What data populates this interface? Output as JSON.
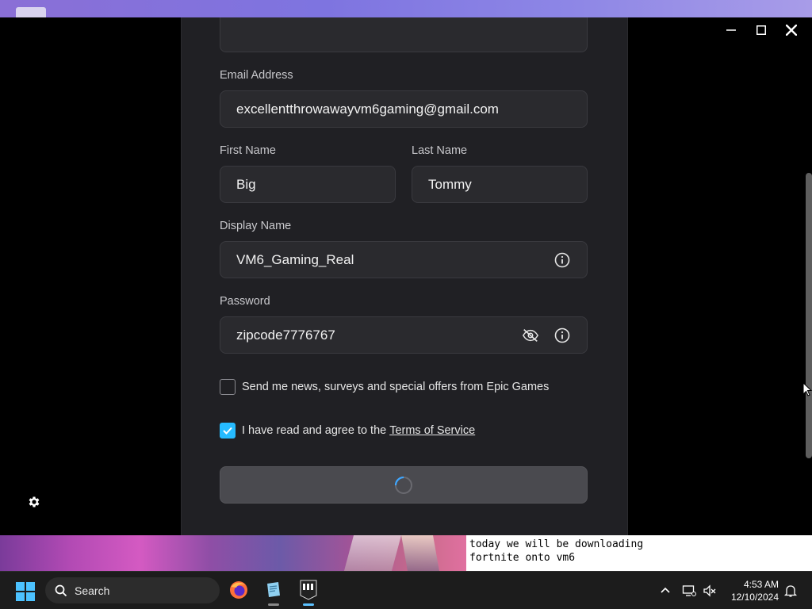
{
  "form": {
    "email_label": "Email Address",
    "email_value": "excellentthrowawayvm6gaming@gmail.com",
    "first_name_label": "First Name",
    "first_name_value": "Big",
    "last_name_label": "Last Name",
    "last_name_value": "Tommy",
    "display_name_label": "Display Name",
    "display_name_value": "VM6_Gaming_Real",
    "password_label": "Password",
    "password_value": "zipcode7776767",
    "newsletter_label": "Send me news, surveys and special offers from Epic Games",
    "newsletter_checked": false,
    "tos_prefix": "I have read and agree to the",
    "tos_link": "Terms of Service",
    "tos_checked": true,
    "accent_color": "#26bbff"
  },
  "caption": {
    "line1": "today we will be downloading",
    "line2": "fortnite onto vm6"
  },
  "taskbar": {
    "search_placeholder": "Search",
    "apps": [
      "firefox-icon",
      "notepad-icon",
      "epic-games-icon"
    ],
    "time": "4:53 AM",
    "date": "12/10/2024"
  }
}
